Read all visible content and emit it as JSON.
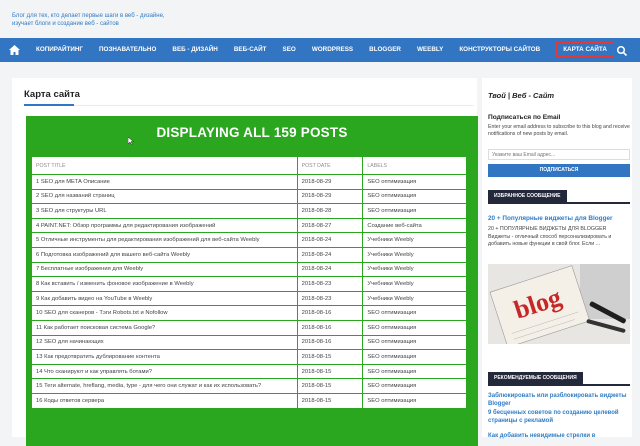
{
  "header": {
    "tagline": "Блог для тех, кто делает первые шаги в веб - дизайне, изучает блоги и создание веб - сайтов"
  },
  "nav": {
    "home_icon": "home-icon",
    "search_icon": "search-icon",
    "items": [
      "КОПИРАЙТИНГ",
      "ПОЗНАВАТЕЛЬНО",
      "ВЕБ - ДИЗАЙН",
      "ВЕБ-САЙТ",
      "SEO",
      "WORDPRESS",
      "BLOGGER",
      "WEEBLY",
      "КОНСТРУКТОРЫ САЙТОВ",
      "КАРТА САЙТА"
    ],
    "active_index": 9
  },
  "main": {
    "title": "Карта сайта",
    "banner": "DISPLAYING ALL 159 POSTS",
    "columns": [
      "POST TITLE",
      "POST DATE",
      "LABELS"
    ],
    "rows": [
      {
        "n": "1",
        "title": "SEO для META Описание",
        "date": "2018-08-29",
        "label": "SEO оптимизация"
      },
      {
        "n": "2",
        "title": "SEO для названий страниц",
        "date": "2018-08-29",
        "label": "SEO оптимизация"
      },
      {
        "n": "3",
        "title": "SEO для структуры URL",
        "date": "2018-08-28",
        "label": "SEO оптимизация"
      },
      {
        "n": "4",
        "title": "PAINT.NET: Обзор программы для редактирования изображений",
        "date": "2018-08-27",
        "label": "Создание веб-сайта"
      },
      {
        "n": "5",
        "title": "Отличные инструменты для редактирования изображений для веб-сайта Weebly",
        "date": "2018-08-24",
        "label": "Учебники Weebly"
      },
      {
        "n": "6",
        "title": "Подготовка изображений для вашего веб-сайта Weebly",
        "date": "2018-08-24",
        "label": "Учебники Weebly"
      },
      {
        "n": "7",
        "title": "Бесплатные изображения для Weebly",
        "date": "2018-08-24",
        "label": "Учебники Weebly"
      },
      {
        "n": "8",
        "title": "Как вставить / изменить фоновое изображение в Weebly",
        "date": "2018-08-23",
        "label": "Учебники Weebly"
      },
      {
        "n": "9",
        "title": "Как добавить видео на YouTube в Weebly",
        "date": "2018-08-23",
        "label": "Учебники Weebly"
      },
      {
        "n": "10",
        "title": "SEO для сканеров - Тэги Robots.txt и Nofollow",
        "date": "2018-08-16",
        "label": "SEO оптимизация"
      },
      {
        "n": "11",
        "title": "Как работает поисковая система Google?",
        "date": "2018-08-16",
        "label": "SEO оптимизация"
      },
      {
        "n": "12",
        "title": "SEO для начинающих",
        "date": "2018-08-16",
        "label": "SEO оптимизация"
      },
      {
        "n": "13",
        "title": "Как предотвратить дублирование контента",
        "date": "2018-08-15",
        "label": "SEO оптимизация"
      },
      {
        "n": "14",
        "title": "Что сканируют и как управлять ботами?",
        "date": "2018-08-15",
        "label": "SEO оптимизация"
      },
      {
        "n": "15",
        "title": "Теги alternate, hreflang, media, type - для чего они служат и как их использовать?",
        "date": "2018-08-15",
        "label": "SEO оптимизация"
      },
      {
        "n": "16",
        "title": "Коды ответов сервера",
        "date": "2018-08-15",
        "label": "SEO оптимизация"
      }
    ]
  },
  "sidebar": {
    "blog_title": "Твой | Веб - Сайт",
    "subscribe_heading": "Подписаться по Email",
    "subscribe_desc": "Enter your email address to subscribe to this blog and receive notifications of new posts by email.",
    "email_placeholder": "Укажите ваш Email адрес...",
    "subscribe_button": "ПОДПИСАТЬСЯ",
    "featured_label": "ИЗБРАННОЕ СООБЩЕНИЕ",
    "featured_title": "20 + Популярные виджеты для Blogger",
    "featured_text": "20 + ПОПУЛЯРНЫЕ ВИДЖЕТЫ ДЛЯ BLOGGER Виджеты - отличный способ персонализировать и добавить новые функции в свой блог. Если ...",
    "image_word": "blog",
    "recommended_label": "РЕКОМЕНДУЕМЫЕ СООБЩЕНИЯ",
    "recommended": [
      "Заблюкировать или разблокировать виджеты Blogger",
      "9 бесценных советов по созданию целевой страницы с рекламой",
      "Как добавить невидимые стрелки в"
    ]
  },
  "colors": {
    "nav_bg": "#3275c2",
    "green": "#2aa61f",
    "link": "#2f7cc7",
    "active_outline": "#e53935"
  }
}
